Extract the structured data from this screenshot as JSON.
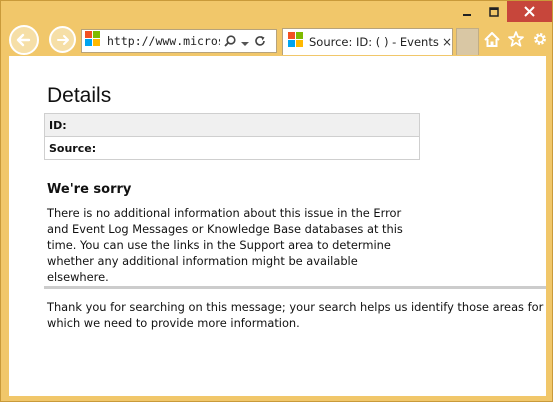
{
  "window": {
    "caption": {
      "minimize": "–",
      "maximize": "□",
      "close": "✕"
    }
  },
  "toolbar": {
    "address_url": "http://www.microso...",
    "tab_title": "Source: ID: ( ) - Events ...",
    "tab_close": "×",
    "icons": [
      "back-arrow-icon",
      "forward-arrow-icon",
      "windows-logo-icon",
      "search-icon",
      "dropdown-arrow-icon",
      "refresh-icon",
      "home-icon",
      "favorites-star-icon",
      "settings-gear-icon"
    ]
  },
  "page": {
    "details_heading": "Details",
    "table": [
      {
        "label": "ID:"
      },
      {
        "label": "Source:"
      }
    ],
    "sorry_heading": "We're sorry",
    "sorry_text": "There is no additional information about this issue in the Error and Event Log Messages or Knowledge Base databases at this time. You can use the links in the Support area to determine whether any additional information might be available elsewhere.",
    "thanks_text": "Thank you for searching on this message; your search helps us identify those areas for which we need to provide more information."
  },
  "colors": {
    "frame": "#f1c76a",
    "close_button": "#c7463b",
    "table_header_bg": "#f0f0f0",
    "divider": "#cccccc"
  }
}
